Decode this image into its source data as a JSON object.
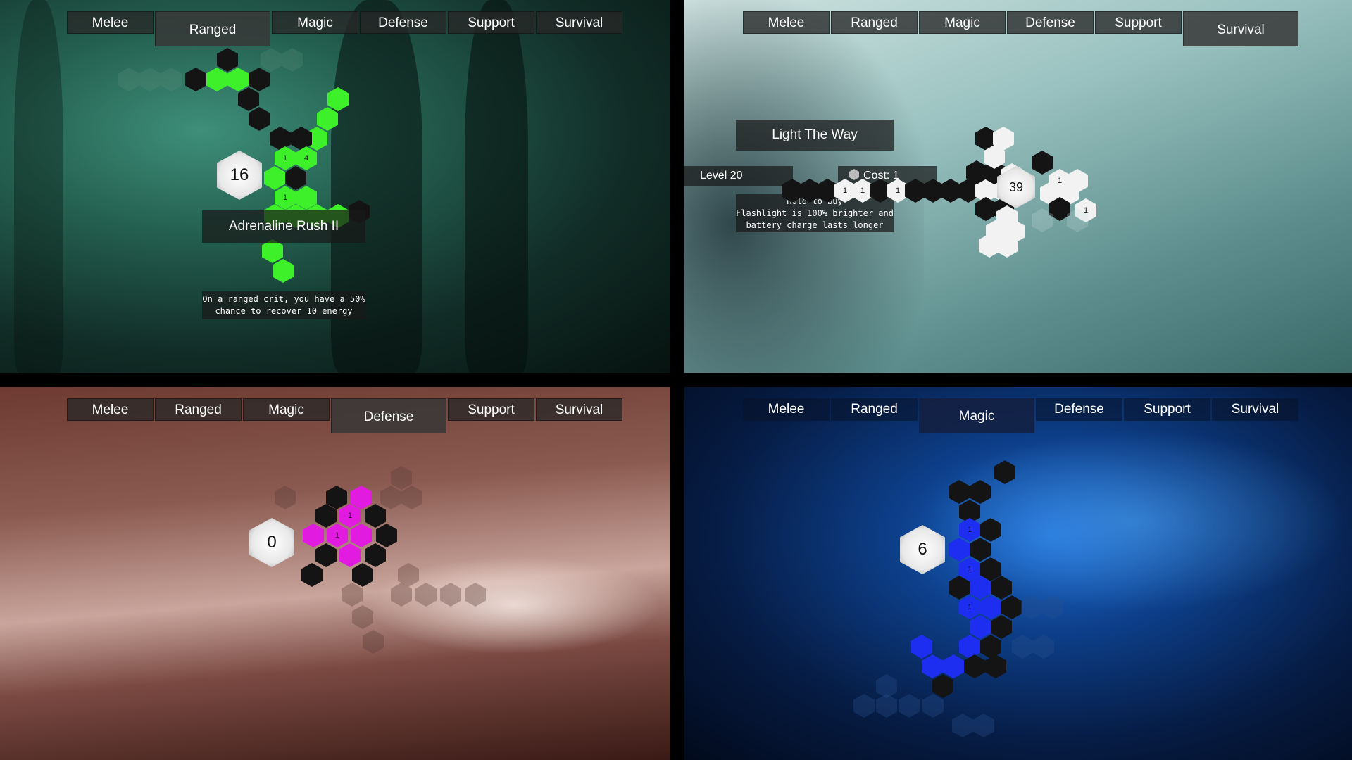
{
  "tabs": [
    "Melee",
    "Ranged",
    "Magic",
    "Defense",
    "Support",
    "Survival"
  ],
  "panels": [
    {
      "active_tab": "Ranged",
      "points": "16",
      "skill_title": "Adrenaline Rush II",
      "skill_desc_1": "On a ranged crit, you have a 50%",
      "skill_desc_2": "chance to recover 10 energy",
      "node_labels": [
        "1",
        "4",
        "1"
      ],
      "accent": "#3df02a"
    },
    {
      "active_tab": "Survival",
      "points": "39",
      "skill_title": "Light The Way",
      "level": "Level 20",
      "cost": "Cost: 1",
      "hint": "Hold to buy",
      "skill_desc_1": "Flashlight is 100% brighter and",
      "skill_desc_2": "battery charge lasts longer",
      "node_labels": [
        "1",
        "1",
        "1",
        "1",
        "1"
      ],
      "accent": "#f2f2f2"
    },
    {
      "active_tab": "Defense",
      "points": "0",
      "node_labels": [
        "1",
        "1"
      ],
      "accent": "#e11ce0"
    },
    {
      "active_tab": "Magic",
      "points": "6",
      "node_labels": [
        "1",
        "1",
        "1"
      ],
      "accent": "#1e2ef0"
    }
  ]
}
